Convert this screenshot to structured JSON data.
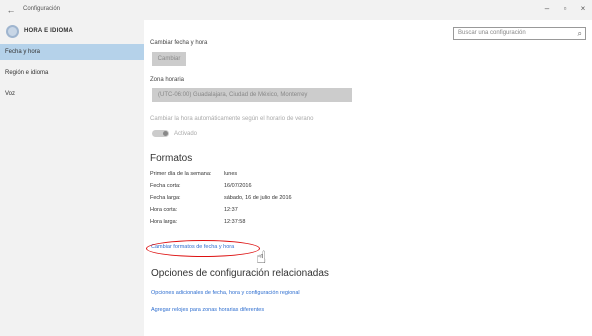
{
  "window": {
    "title": "Configuración",
    "back": "←",
    "minimize": "–",
    "maximize": "▫",
    "close": "×"
  },
  "sidebar": {
    "header": "HORA E IDIOMA",
    "items": [
      {
        "label": "Fecha y hora",
        "active": true
      },
      {
        "label": "Región e idioma",
        "active": false
      },
      {
        "label": "Voz",
        "active": false
      }
    ]
  },
  "search": {
    "placeholder": "Buscar una configuración",
    "icon": "search-icon"
  },
  "main": {
    "change_datetime_label": "Cambiar fecha y hora",
    "change_button": "Cambiar",
    "timezone_label": "Zona horaria",
    "timezone_value": "(UTC-06:00) Guadalajara, Ciudad de México, Monterrey",
    "dst_label": "Cambiar la hora automáticamente según el horario de verano",
    "dst_state": "Activado",
    "formats_heading": "Formatos",
    "formats": [
      {
        "key": "Primer día de la semana:",
        "value": "lunes"
      },
      {
        "key": "Fecha corta:",
        "value": "16/07/2016"
      },
      {
        "key": "Fecha larga:",
        "value": "sábado, 16 de julio de 2016"
      },
      {
        "key": "Hora corta:",
        "value": "12:37"
      },
      {
        "key": "Hora larga:",
        "value": "12:37:58"
      }
    ],
    "change_formats_link": "Cambiar formatos de fecha y hora",
    "related_heading": "Opciones de configuración relacionadas",
    "related_links": [
      "Opciones adicionales de fecha, hora y configuración regional",
      "Agregar relojes para zonas horarias diferentes"
    ]
  },
  "colors": {
    "accent": "#2f6fd0",
    "active_item": "#b5d2ea",
    "annotation": "#d11111"
  }
}
